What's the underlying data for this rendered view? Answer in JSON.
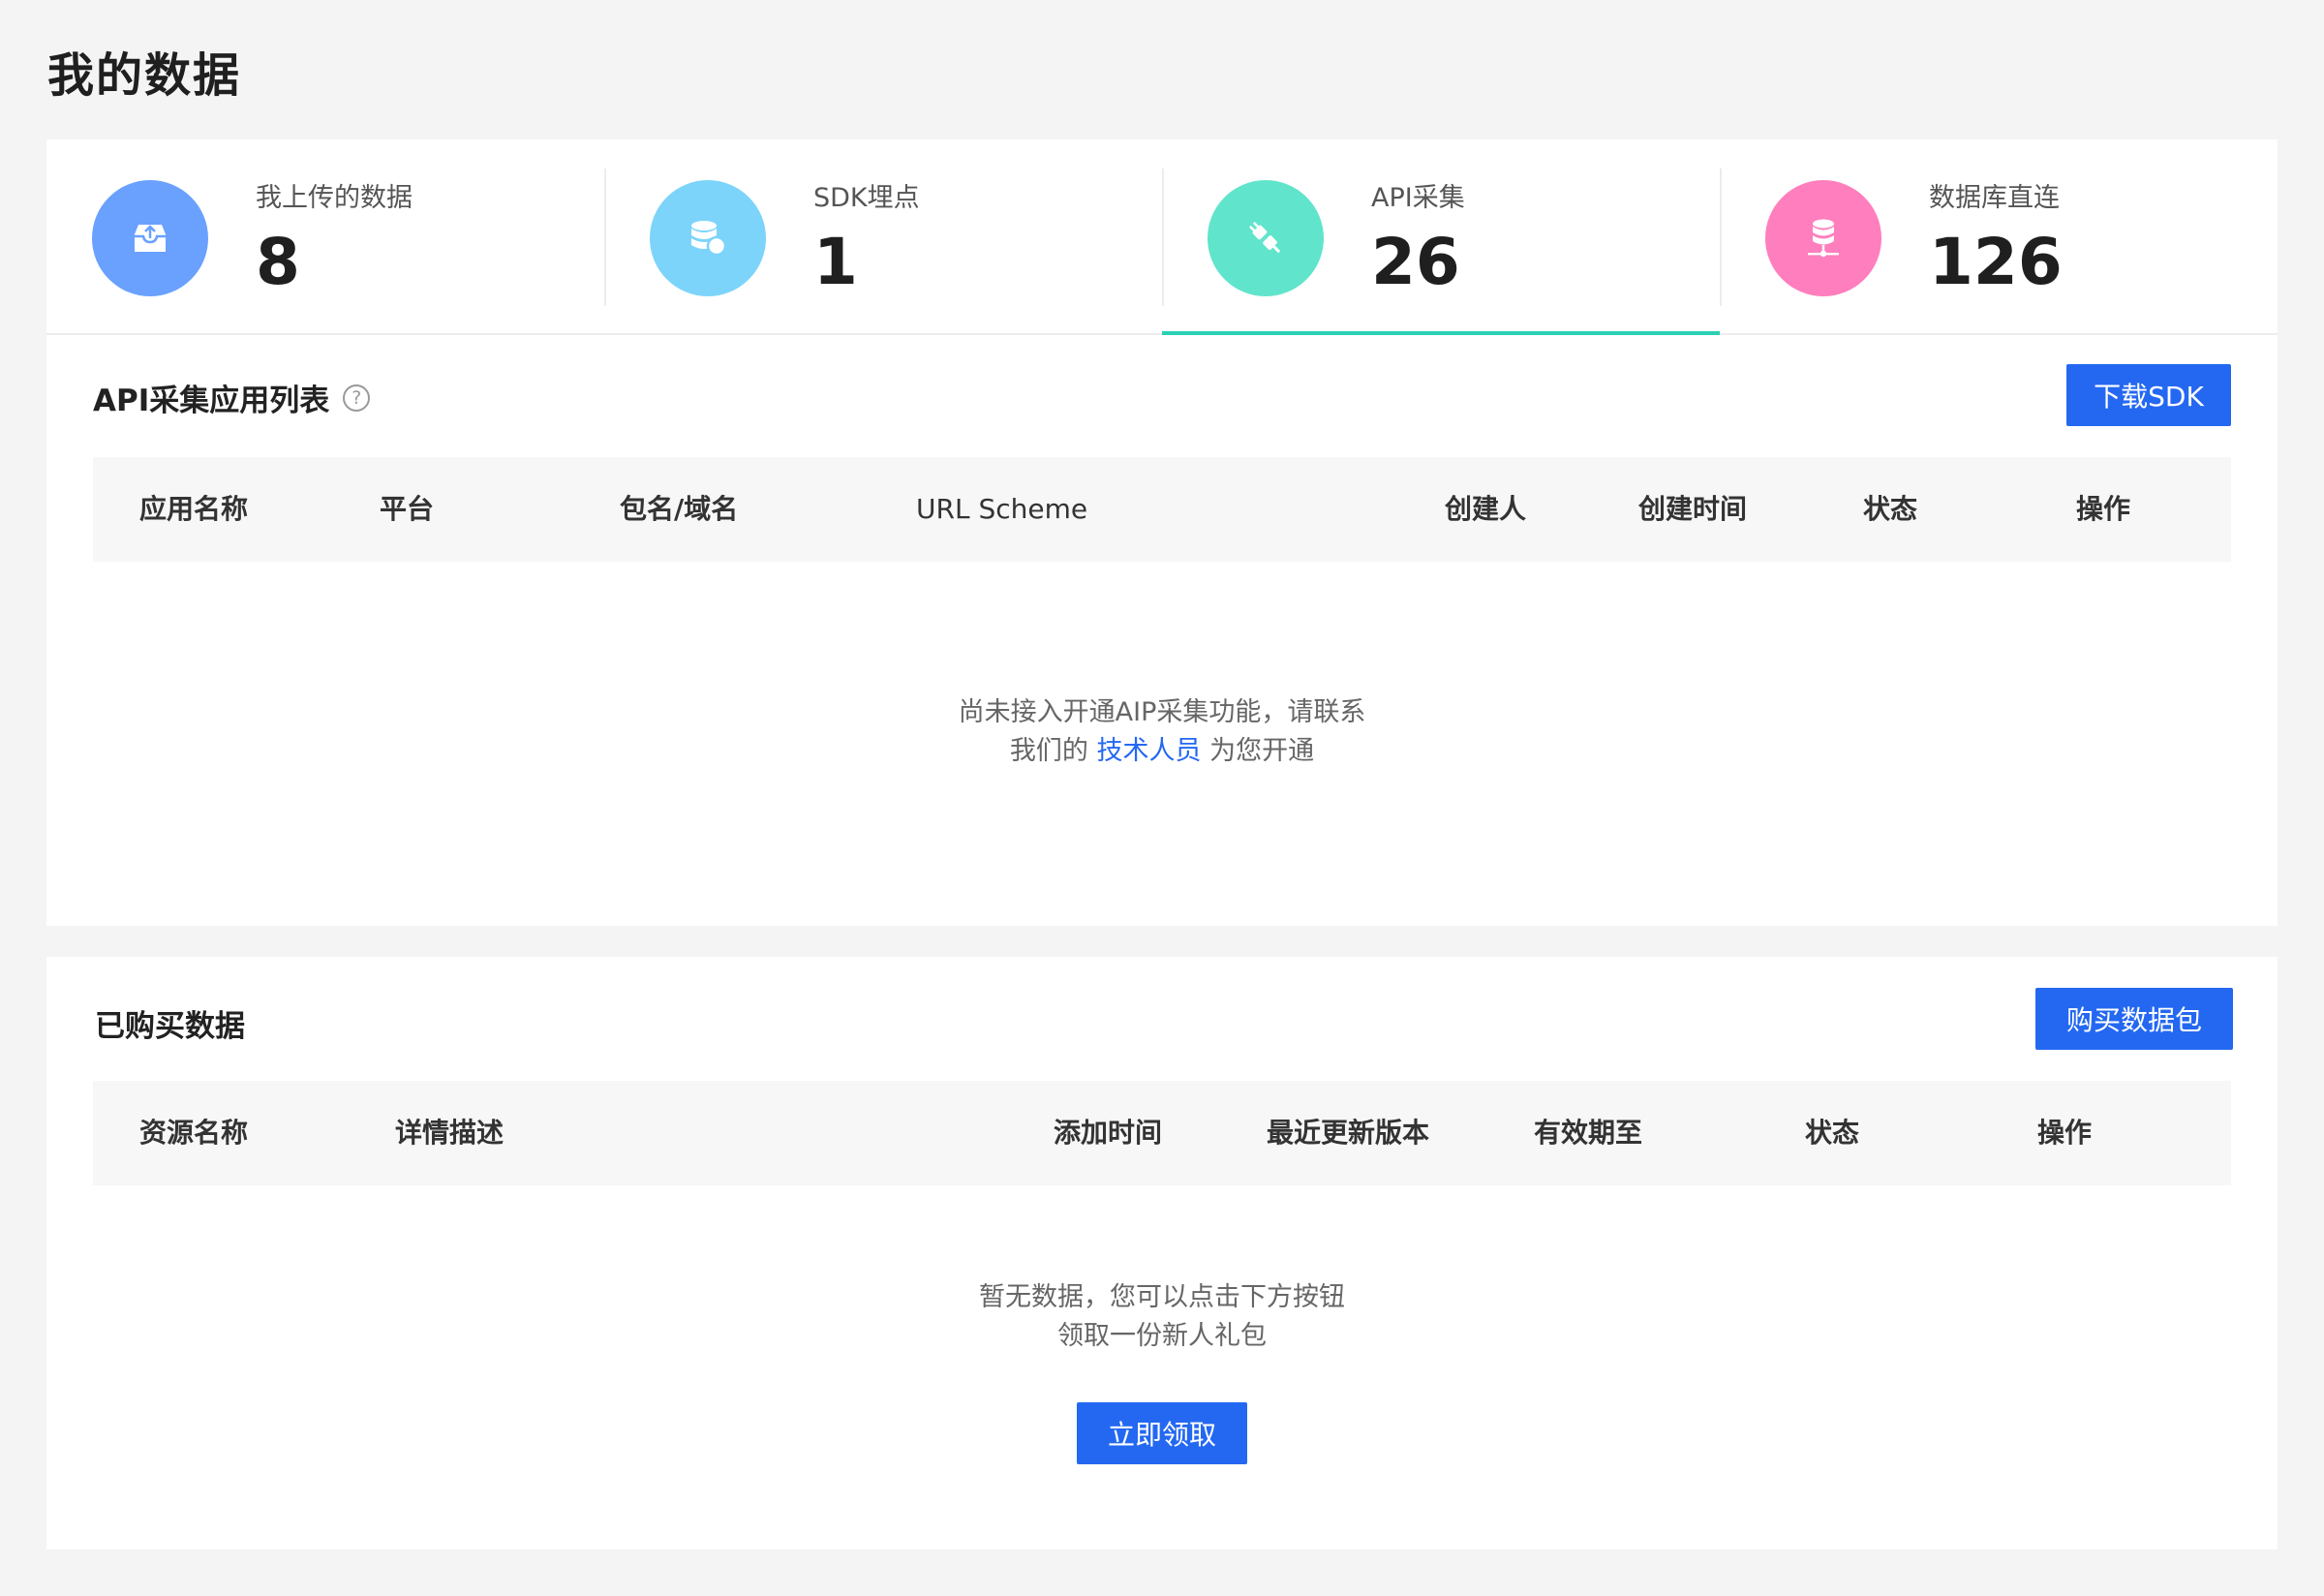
{
  "page": {
    "title": "我的数据"
  },
  "stats": [
    {
      "label": "我上传的数据",
      "value": "8",
      "icon": "inbox-upload-icon",
      "color": "#6aa1ff",
      "active": false
    },
    {
      "label": "SDK埋点",
      "value": "1",
      "icon": "database-icon",
      "color": "#7cd4fb",
      "active": false
    },
    {
      "label": "API采集",
      "value": "26",
      "icon": "plug-icon",
      "color": "#61e4cc",
      "active": true
    },
    {
      "label": "数据库直连",
      "value": "126",
      "icon": "database-network-icon",
      "color": "#ff7ebd",
      "active": false
    }
  ],
  "api_section": {
    "title": "API采集应用列表",
    "help_glyph": "?",
    "download_button": "下载SDK",
    "columns": [
      "应用名称",
      "平台",
      "包名/域名",
      "URL Scheme",
      "创建人",
      "创建时间",
      "状态",
      "操作"
    ],
    "empty_line1": "尚未接入开通AIP采集功能，请联系",
    "empty_line2_prefix": "我们的",
    "empty_link": "技术人员",
    "empty_line2_suffix": "为您开通"
  },
  "bought_section": {
    "title": "已购买数据",
    "buy_button": "购买数据包",
    "columns": [
      "资源名称",
      "详情描述",
      "添加时间",
      "最近更新版本",
      "有效期至",
      "状态",
      "操作"
    ],
    "empty_line1": "暂无数据，您可以点击下方按钮",
    "empty_line2": "领取一份新人礼包",
    "claim_button": "立即领取"
  },
  "colors": {
    "accent": "#2468f2",
    "active_tab": "#2ad1b5"
  }
}
